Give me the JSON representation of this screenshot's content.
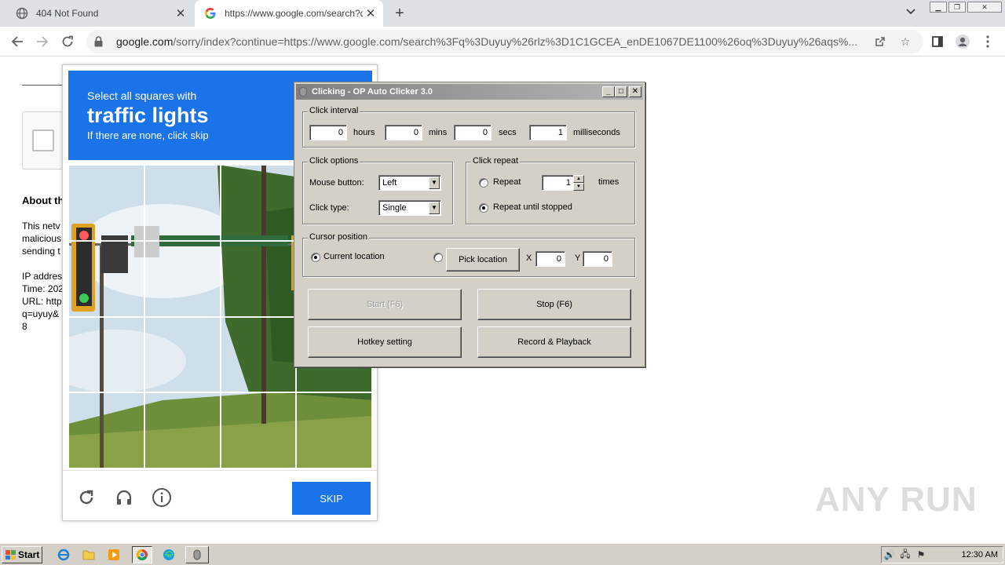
{
  "browser": {
    "tabs": [
      {
        "title": "404 Not Found",
        "active": false
      },
      {
        "title": "https://www.google.com/search?q=",
        "active": true
      }
    ],
    "address": {
      "host": "google.com",
      "path": "/sorry/index?continue=https://www.google.com/search%3Fq%3Duyuy%26rlz%3D1C1GCEA_enDE1067DE1100%26oq%3Duyuy%26aqs%..."
    }
  },
  "page": {
    "about_heading": "About th",
    "lines": [
      "This netv",
      "malicious",
      "sending t",
      "IP addres",
      "Time: 202",
      "URL: http",
      "q=uyuy&",
      "8"
    ]
  },
  "captcha": {
    "line1": "Select all squares with",
    "line2": "traffic lights",
    "line3": "If there are none, click skip",
    "skip_label": "SKIP"
  },
  "autoclicker": {
    "title": "Clicking - OP Auto Clicker 3.0",
    "interval": {
      "legend": "Click interval",
      "hours_value": "0",
      "hours_label": "hours",
      "mins_value": "0",
      "mins_label": "mins",
      "secs_value": "0",
      "secs_label": "secs",
      "ms_value": "1",
      "ms_label": "milliseconds"
    },
    "options": {
      "legend": "Click options",
      "mouse_button_label": "Mouse button:",
      "mouse_button_value": "Left",
      "click_type_label": "Click type:",
      "click_type_value": "Single"
    },
    "repeat": {
      "legend": "Click repeat",
      "repeat_label": "Repeat",
      "repeat_value": "1",
      "times_label": "times",
      "until_stopped_label": "Repeat until stopped",
      "selected": "until_stopped"
    },
    "cursor": {
      "legend": "Cursor position",
      "current_label": "Current location",
      "pick_label": "Pick location",
      "x_label": "X",
      "x_value": "0",
      "y_label": "Y",
      "y_value": "0",
      "selected": "current"
    },
    "buttons": {
      "start": "Start (F6)",
      "stop": "Stop (F6)",
      "hotkey": "Hotkey setting",
      "record": "Record & Playback"
    }
  },
  "watermark": "ANY RUN",
  "taskbar": {
    "start_label": "Start",
    "clock": "12:30 AM"
  },
  "colors": {
    "captcha_blue": "#1a73e8",
    "win_face": "#d4d0c8"
  }
}
